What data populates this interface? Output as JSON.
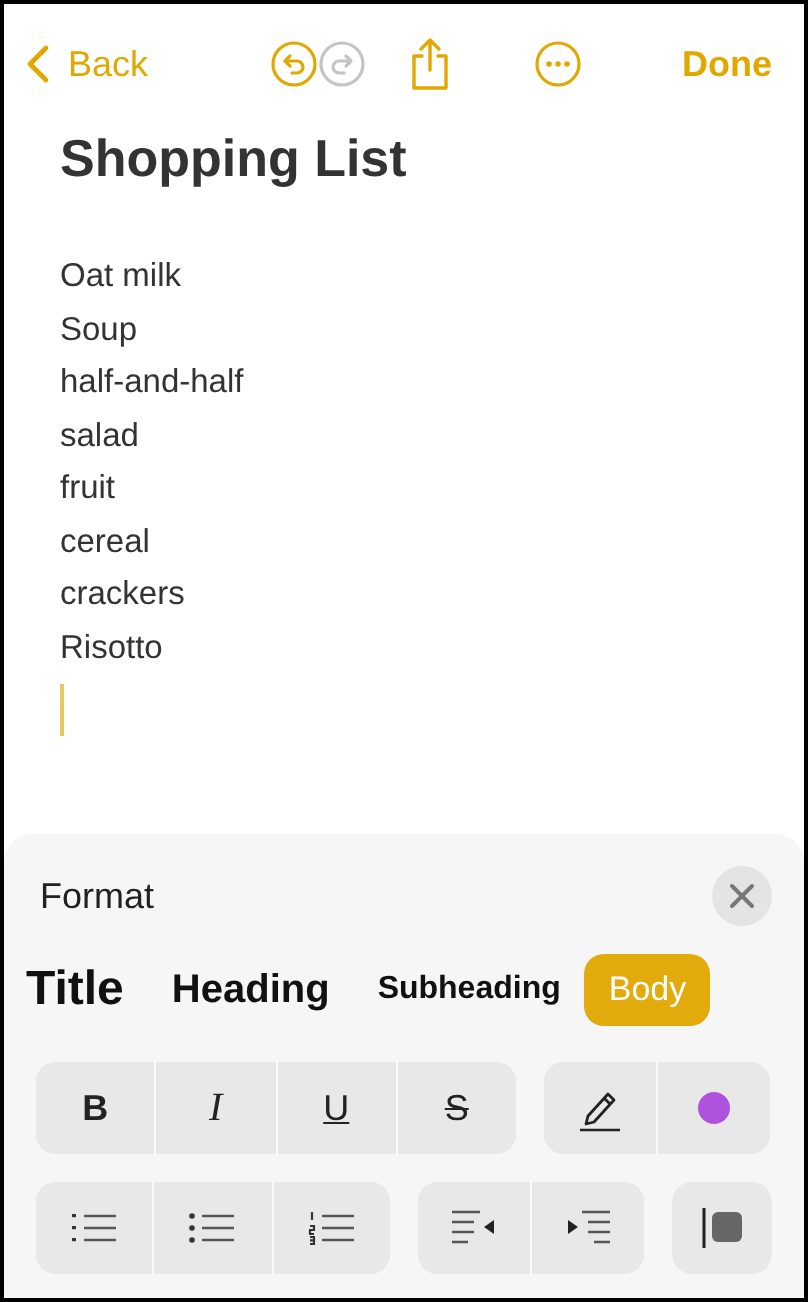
{
  "nav": {
    "back": "Back",
    "done": "Done",
    "undo_enabled": true,
    "redo_enabled": false
  },
  "note": {
    "title": "Shopping List",
    "lines": [
      "Oat milk",
      "Soup",
      "half-and-half",
      "salad",
      "fruit",
      "cereal",
      "crackers",
      "Risotto"
    ]
  },
  "format": {
    "title": "Format",
    "styles": [
      {
        "label": "Title",
        "kind": "title",
        "selected": false
      },
      {
        "label": "Heading",
        "kind": "heading",
        "selected": false
      },
      {
        "label": "Subheading",
        "kind": "subheading",
        "selected": false
      },
      {
        "label": "Body",
        "kind": "body",
        "selected": true
      }
    ],
    "text_buttons": [
      {
        "label": "B",
        "kind": "bold"
      },
      {
        "label": "I",
        "kind": "italic"
      },
      {
        "label": "U",
        "kind": "underline"
      },
      {
        "label": "S",
        "kind": "strike"
      }
    ],
    "color_button": {
      "color": "#af52de"
    }
  }
}
